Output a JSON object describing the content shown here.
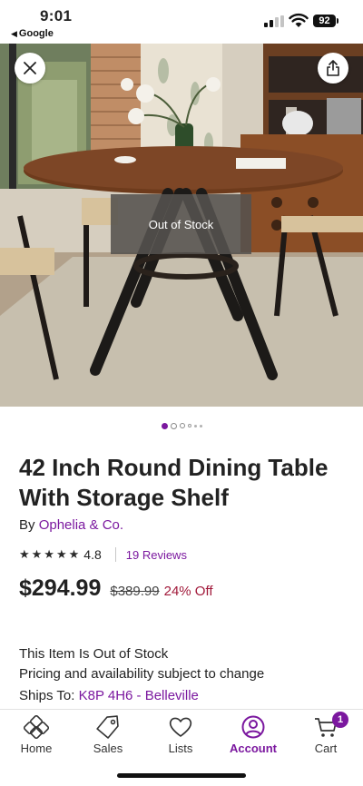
{
  "status_bar": {
    "time": "9:01",
    "back_app": "Google",
    "back_icon": "back-triangle-icon",
    "battery": "92"
  },
  "gallery": {
    "overlay_text": "Out of Stock",
    "dots": [
      {
        "state": "active",
        "size": "large"
      },
      {
        "state": "inactive",
        "size": "large"
      },
      {
        "state": "inactive",
        "size": "medium"
      },
      {
        "state": "inactive",
        "size": "small"
      },
      {
        "state": "inactive",
        "size": "tiny"
      },
      {
        "state": "inactive",
        "size": "tiny"
      }
    ],
    "colors": {
      "active_dot": "#7b189f",
      "inactive_dot": "#9a9a9a"
    }
  },
  "product": {
    "title": "42 Inch Round Dining Table With Storage Shelf",
    "by_prefix": "By ",
    "brand": "Ophelia & Co.",
    "stars": "★★★★★",
    "rating": "4.8",
    "reviews": "19 Reviews",
    "price": "$294.99",
    "was_price": "$389.99",
    "discount": "24% Off"
  },
  "availability": {
    "status": "This Item Is Out of Stock",
    "note": "Pricing and availability subject to change",
    "ships_prefix": "Ships To: ",
    "ships_location": "K8P 4H6 - Belleville"
  },
  "bottom_nav": {
    "items": [
      {
        "label": "Home",
        "icon": "home-icon"
      },
      {
        "label": "Sales",
        "icon": "tag-icon"
      },
      {
        "label": "Lists",
        "icon": "heart-icon"
      },
      {
        "label": "Account",
        "icon": "account-icon",
        "active": true
      },
      {
        "label": "Cart",
        "icon": "cart-icon",
        "badge": "1"
      }
    ]
  },
  "colors": {
    "accent": "#7b189f",
    "discount": "#a1193a"
  }
}
